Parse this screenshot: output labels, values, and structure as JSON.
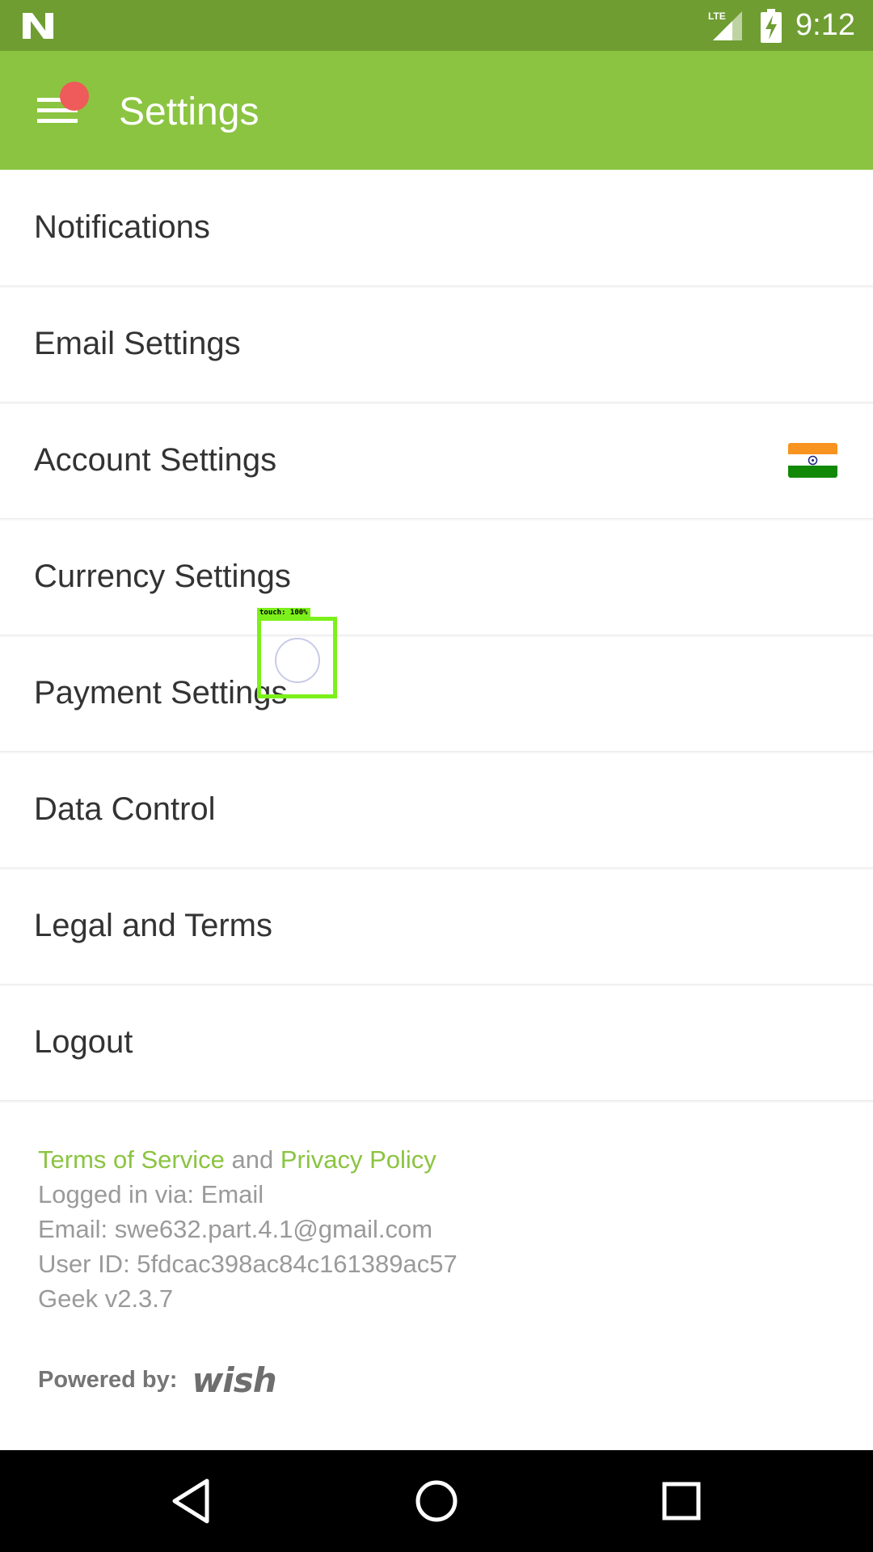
{
  "status_bar": {
    "time": "9:12",
    "network_label": "LTE",
    "icons": [
      "n-logo-icon",
      "lte-signal-icon",
      "battery-charging-icon"
    ]
  },
  "app_bar": {
    "title": "Settings",
    "menu_icon": "hamburger-menu-icon",
    "badge_color": "#ef5a5a"
  },
  "settings": {
    "items": [
      {
        "label": "Notifications"
      },
      {
        "label": "Email Settings"
      },
      {
        "label": "Account Settings",
        "trailing_icon": "india-flag-icon"
      },
      {
        "label": "Currency Settings"
      },
      {
        "label": "Payment Settings"
      },
      {
        "label": "Data Control"
      },
      {
        "label": "Legal and Terms"
      },
      {
        "label": "Logout"
      }
    ]
  },
  "footer": {
    "terms_link": "Terms of Service",
    "and_text": "and",
    "privacy_link": "Privacy Policy",
    "logged_in_via": "Logged in via: Email",
    "email": "Email: swe632.part.4.1@gmail.com",
    "user_id": "User ID: 5fdcac398ac84c161389ac57",
    "version": "Geek v2.3.7",
    "powered_by": "Powered by:",
    "brand_logo": "wish"
  },
  "touch_indicator": {
    "label": "touch: 100%"
  },
  "nav_bar": {
    "icons": [
      "back-icon",
      "home-icon",
      "recents-icon"
    ]
  },
  "colors": {
    "status_bar": "#6f9d32",
    "app_bar": "#8bc441",
    "link": "#8bc441",
    "text_primary": "#333333",
    "text_secondary": "#9a9a9a",
    "nav_bar": "#000000"
  }
}
